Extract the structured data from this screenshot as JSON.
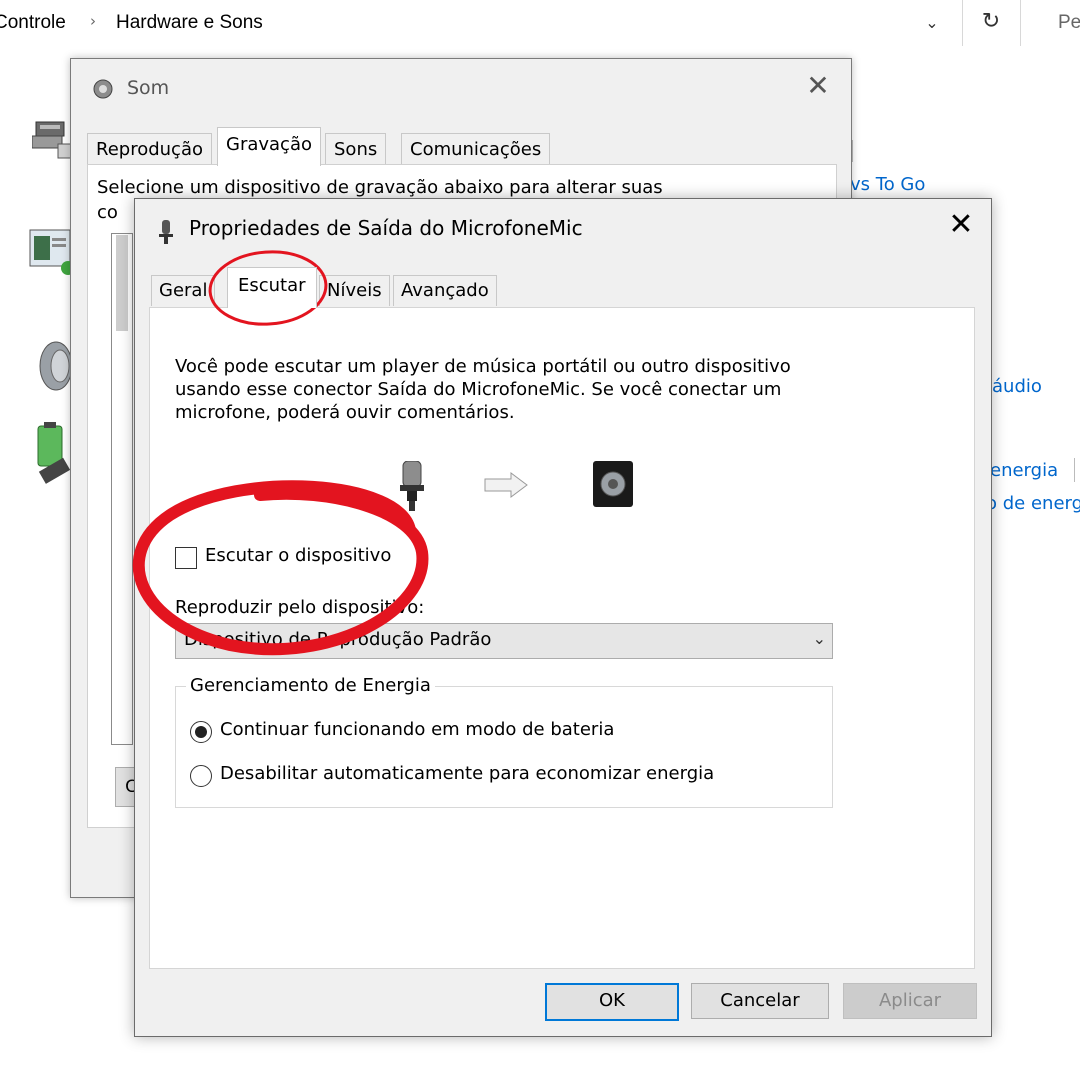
{
  "breadcrumb": {
    "parent": "Controle",
    "current": "Hardware e Sons",
    "search_partial": "Pe"
  },
  "address_bar": {
    "dropdown_icon": "chevron-down-icon",
    "refresh_icon": "refresh-icon"
  },
  "background_panel": {
    "links": [
      "vs To Go",
      "áudio",
      "energia",
      "o de energ"
    ]
  },
  "som_window": {
    "title": "Som",
    "tabs": [
      "Reprodução",
      "Gravação",
      "Sons",
      "Comunicações"
    ],
    "selected_tab": "Gravação",
    "description_line1": "Selecione um dispositivo de gravação abaixo para alterar suas",
    "description_line2_partial": "co",
    "button_partial": "C"
  },
  "dialog": {
    "title": "Propriedades de Saída do MicrofoneMic",
    "tabs": [
      "Geral",
      "Escutar",
      "Níveis",
      "Avançado"
    ],
    "selected_tab": "Escutar",
    "description": "Você pode escutar um player de música portátil ou outro dispositivo usando esse conector Saída do MicrofoneMic. Se você conectar um microfone, poderá ouvir comentários.",
    "listen_checkbox": {
      "label": "Escutar o dispositivo",
      "checked": false
    },
    "playback_label": "Reproduzir pelo dispositivo:",
    "playback_select": {
      "value": "Dispositivo de Reprodução Padrão"
    },
    "power_group": {
      "title": "Gerenciamento de Energia",
      "options": [
        {
          "label": "Continuar funcionando em modo de bateria",
          "selected": true
        },
        {
          "label": "Desabilitar automaticamente para economizar energia",
          "selected": false
        }
      ]
    },
    "buttons": {
      "ok": "OK",
      "cancel": "Cancelar",
      "apply": "Aplicar"
    }
  },
  "colors": {
    "link": "#0066cc",
    "annotation": "#e3141f",
    "accent": "#0078d7"
  }
}
